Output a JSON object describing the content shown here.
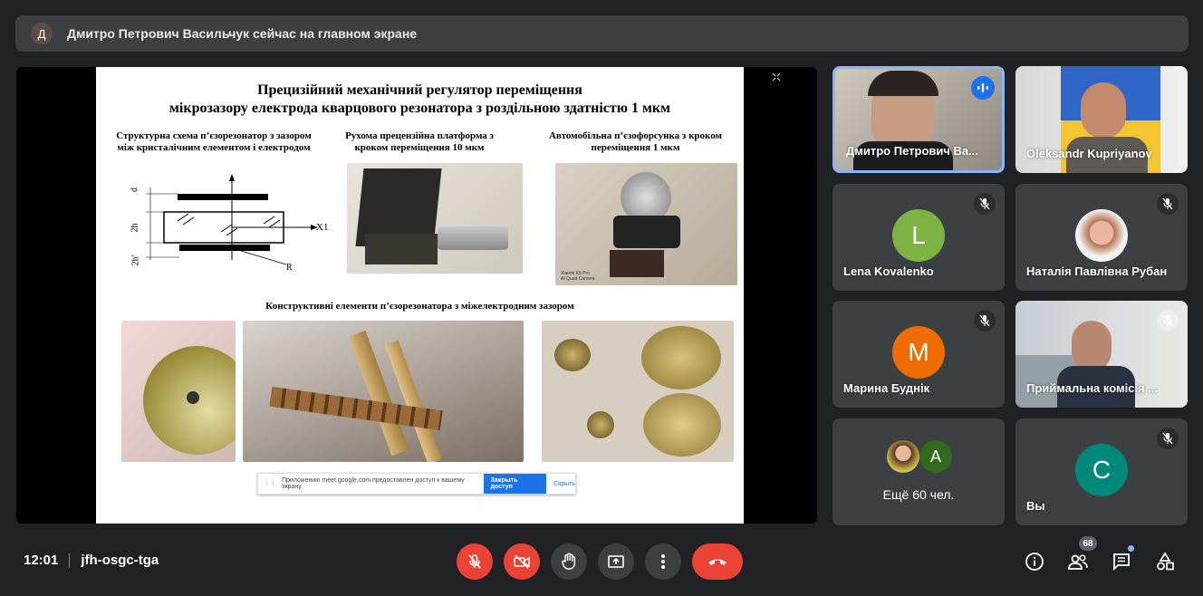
{
  "banner": {
    "avatar_letter": "Д",
    "text": "Дмитро Петрович Васильчук сейчас на главном экране"
  },
  "slide": {
    "title_line1": "Прецизійний механічний регулятор переміщення",
    "title_line2": "мікрозазору електрода кварцового резонатора з роздільною здатністю 1 мкм",
    "cap1": "Структурна схема п’єзорезонатор з зазором між кристалічним елементом і електродом",
    "cap2": "Рухома прецензійна платформа з кроком переміщення 10 мкм",
    "cap3": "Автомобільна п’єзофорсунка з кроком переміщення 1 мкм",
    "cap4": "Конструктивні елементи п’єзорезонатора з міжелектродним зазором",
    "diagram": {
      "d": "d",
      "h2": "2h",
      "h2b": "2h'",
      "x1": "X1",
      "r": "R"
    },
    "photo_credit": "Xiaomi K5 Pro\nAI Quad Camera"
  },
  "share_popup": {
    "text": "Приложению meet.google.com предоставлен доступ к вашему экрану.",
    "stop_button": "Закрыть доступ",
    "hide_button": "Скрыть"
  },
  "participants": [
    {
      "name": "Дмитро Петрович Ва...",
      "speaking": true
    },
    {
      "name": "Oleksandr Kupriyanov"
    },
    {
      "name": "Lena Kovalenko",
      "letter": "L",
      "color": "#7cb342"
    },
    {
      "name": "Наталія Павлівна Рубан"
    },
    {
      "name": "Марина Буднік",
      "letter": "M",
      "color": "#ef6c00"
    },
    {
      "name": "Приймальна комісія ..."
    },
    {
      "name": "Ещё 60 чел.",
      "letter": "A",
      "color": "#33691e"
    },
    {
      "name": "Вы",
      "letter": "C",
      "color": "#00897b"
    }
  ],
  "bottom": {
    "time": "12:01",
    "meeting_code": "jfh-osgc-tga",
    "people_count": "68"
  },
  "colors": {
    "red": "#ea4335",
    "grey": "#3c4043",
    "accent": "#1a73e8"
  }
}
